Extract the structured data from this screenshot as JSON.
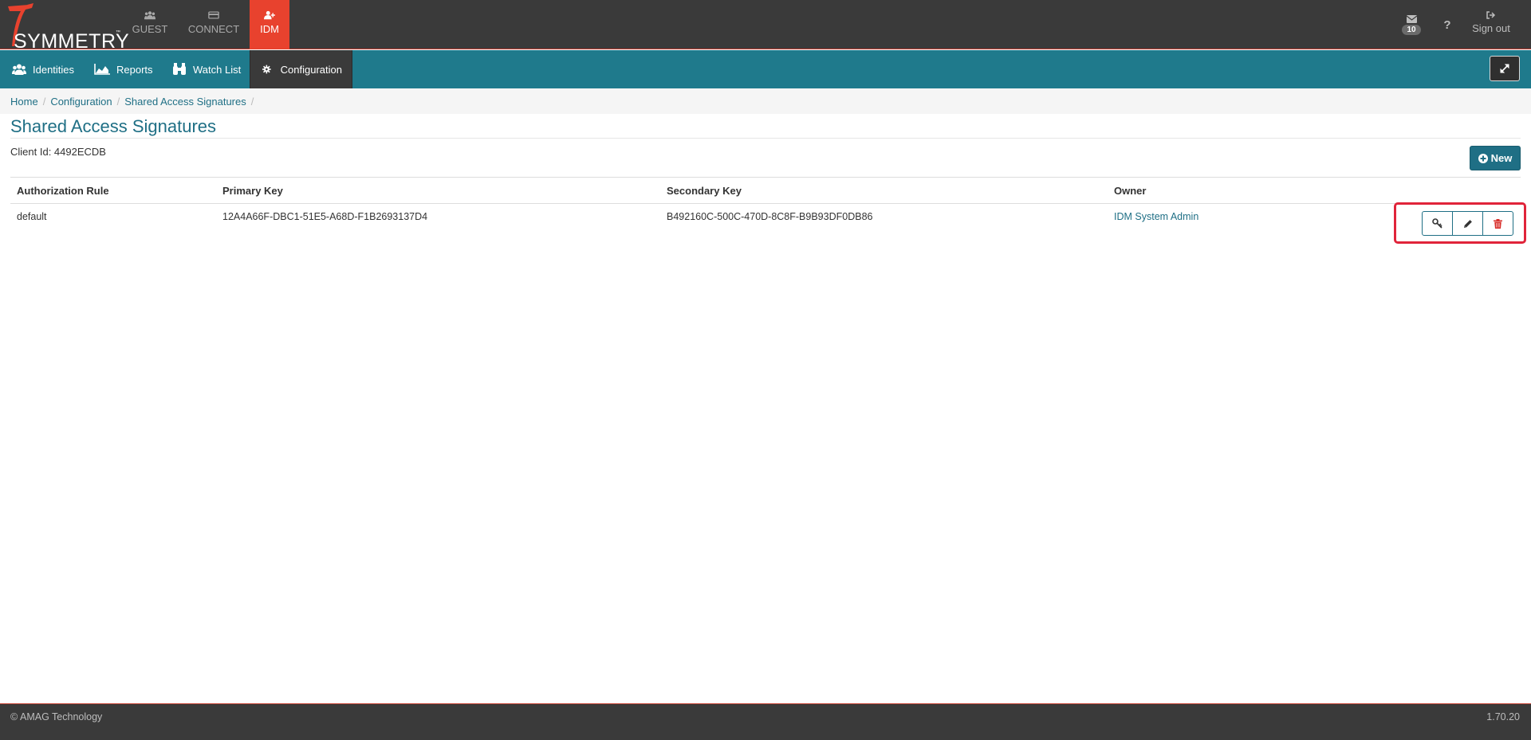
{
  "brand": {
    "logo_text": "SYMMETRY",
    "trademark": "™"
  },
  "app_tabs": [
    {
      "label": "GUEST",
      "icon": "users-icon",
      "active": false
    },
    {
      "label": "CONNECT",
      "icon": "card-icon",
      "active": false
    },
    {
      "label": "IDM",
      "icon": "user-plus-icon",
      "active": true
    }
  ],
  "top_right": {
    "messages_count": "10",
    "help_label": "?",
    "signout_label": "Sign out"
  },
  "nav": {
    "items": [
      {
        "label": "Identities",
        "icon": "users-icon"
      },
      {
        "label": "Reports",
        "icon": "area-chart-icon"
      },
      {
        "label": "Watch List",
        "icon": "binoculars-icon"
      },
      {
        "label": "Configuration",
        "icon": "gear-icon",
        "active": true
      }
    ]
  },
  "breadcrumb": [
    "Home",
    "Configuration",
    "Shared Access Signatures"
  ],
  "page": {
    "title": "Shared Access Signatures",
    "client_id": "Client Id: 4492ECDB",
    "new_button": "New"
  },
  "table": {
    "columns": [
      "Authorization Rule",
      "Primary Key",
      "Secondary Key",
      "Owner"
    ],
    "rows": [
      {
        "rule": "default",
        "primary_key": "12A4A66F-DBC1-51E5-A68D-F1B2693137D4",
        "secondary_key": "B492160C-500C-470D-8C8F-B9B93DF0DB86",
        "owner": "IDM System Admin"
      }
    ]
  },
  "footer": {
    "copyright": "© AMAG Technology",
    "version": "1.70.20"
  },
  "colors": {
    "topbar": "#3a3a3a",
    "accent_red": "#e8422e",
    "navbar_teal": "#1f7a8c",
    "link": "#1f6f85",
    "highlight": "#e0243a"
  }
}
